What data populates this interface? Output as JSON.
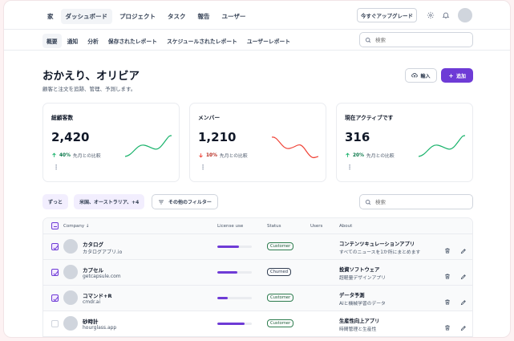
{
  "nav": {
    "links": [
      "家",
      "ダッシュボード",
      "プロジェクト",
      "タスク",
      "報告",
      "ユーザー"
    ],
    "upgrade_label": "今すぐアップグレード"
  },
  "subnav": {
    "links": [
      "概要",
      "通知",
      "分析",
      "保存されたレポート",
      "スケジュールされたレポート",
      "ユーザーレポート"
    ],
    "search_placeholder": "検索"
  },
  "header": {
    "title": "おかえり、オリビア",
    "subtitle": "顧客と注文を追跡、管理、予測します。",
    "import_label": "輸入",
    "add_label": "追加"
  },
  "stats": [
    {
      "label": "総顧客数",
      "value": "2,420",
      "change": "40%",
      "direction": "up",
      "compare": "先月との比較",
      "color": "#17b26a"
    },
    {
      "label": "メンバー",
      "value": "1,210",
      "change": "10%",
      "direction": "down",
      "compare": "先月との比較",
      "color": "#f04438"
    },
    {
      "label": "現在アクティブです",
      "value": "316",
      "change": "20%",
      "direction": "up",
      "compare": "先月との比較",
      "color": "#17b26a"
    }
  ],
  "filters": {
    "chip_1": "ずっと",
    "chip_2": "米国、オーストラリア、+4",
    "more_filters": "その他のフィルター",
    "search_placeholder": "検索"
  },
  "table": {
    "headers": {
      "company": "Company",
      "license": "License use",
      "status": "Status",
      "users": "Users",
      "about": "About"
    },
    "rows": [
      {
        "name": "カタログ",
        "site": "カタログアプリ.io",
        "license": 0.62,
        "status": "Customer",
        "about_1": "コンテンツキュレーションアプリ",
        "about_2": "すべてのニュースを1か所にまとめます",
        "checked": true
      },
      {
        "name": "カプセル",
        "site": "getcapsule.com",
        "license": 0.58,
        "status": "Churned",
        "about_1": "投資ソフトウェア",
        "about_2": "超軽量デザインアプリ",
        "checked": true
      },
      {
        "name": "コマンド+R",
        "site": "cmdr.ai",
        "license": 0.3,
        "status": "Customer",
        "about_1": "データ予測",
        "about_2": "AIと機械学習のデータ",
        "checked": true
      },
      {
        "name": "砂時計",
        "site": "hourglass.app",
        "license": 0.8,
        "status": "Customer",
        "about_1": "生産性向上アプリ",
        "about_2": "時間管理と生産性",
        "checked": false
      }
    ]
  }
}
